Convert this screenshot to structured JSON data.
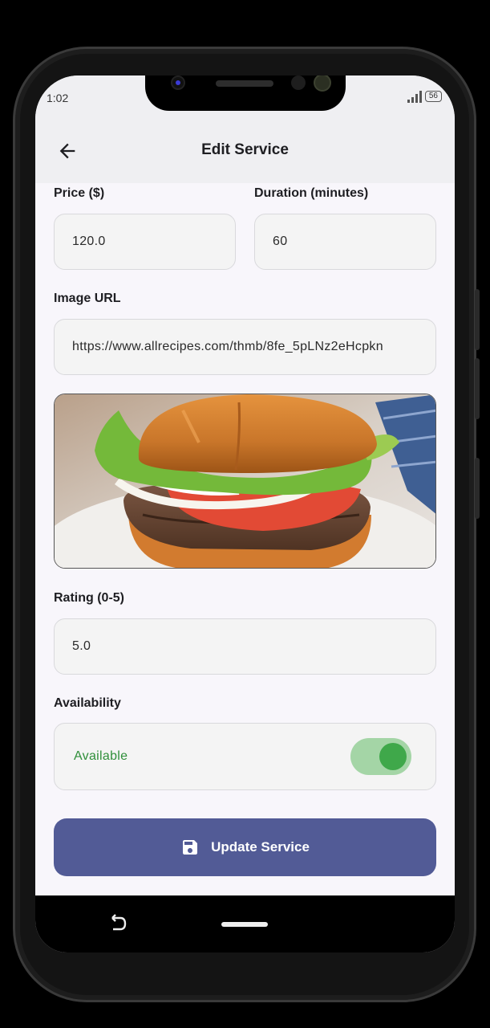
{
  "status_bar": {
    "time": "1:02",
    "battery": "56"
  },
  "app_bar": {
    "title": "Edit Service",
    "back_icon": "arrow-left-icon"
  },
  "form": {
    "price_label": "Price ($)",
    "price_value": "120.0",
    "duration_label": "Duration (minutes)",
    "duration_value": "60",
    "image_url_label": "Image URL",
    "image_url_value": "https://www.allrecipes.com/thmb/8fe_5pLNz2eHcpkn",
    "rating_label": "Rating (0-5)",
    "rating_value": "5.0",
    "availability_label": "Availability",
    "availability_text": "Available",
    "availability_on": true
  },
  "update_button": {
    "label": "Update Service",
    "icon": "save-icon"
  },
  "colors": {
    "accent": "#525b96",
    "available_text": "#2f8f3a",
    "toggle_track": "#a4d5a6",
    "toggle_knob": "#3fa84a"
  }
}
